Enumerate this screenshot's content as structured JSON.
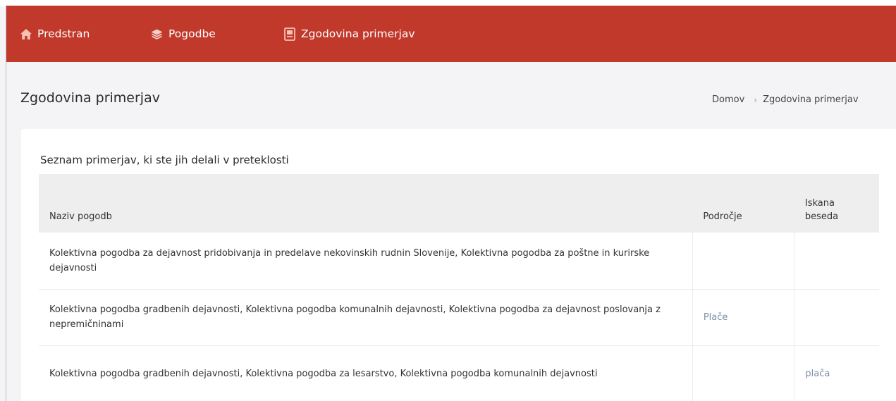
{
  "nav": {
    "home": "Predstran",
    "contracts": "Pogodbe",
    "history": "Zgodovina primerjav"
  },
  "icons": {
    "home": "home-icon",
    "contracts": "layers-icon",
    "history": "document-icon"
  },
  "colors": {
    "navbar": "#c0392b",
    "link": "#7d8da8"
  },
  "page": {
    "title": "Zgodovina primerjav"
  },
  "breadcrumb": {
    "home": "Domov",
    "current": "Zgodovina primerjav"
  },
  "card": {
    "title": "Seznam primerjav, ki ste jih delali v preteklosti"
  },
  "table": {
    "headers": {
      "name": "Naziv pogodb",
      "area": "Področje",
      "word_line1": "Iskana",
      "word_line2": "beseda"
    },
    "rows": [
      {
        "name": "Kolektivna pogodba za dejavnost pridobivanja in predelave nekovinskih rudnin Slovenije, Kolektivna pogodba za poštne in kurirske dejavnosti",
        "area": "",
        "word": ""
      },
      {
        "name": "Kolektivna pogodba gradbenih dejavnosti, Kolektivna pogodba komunalnih dejavnosti, Kolektivna pogodba za dejavnost poslovanja z nepremičninami",
        "area": "Plače",
        "word": ""
      },
      {
        "name": "Kolektivna pogodba gradbenih dejavnosti, Kolektivna pogodba za lesarstvo, Kolektivna pogodba komunalnih dejavnosti",
        "area": "",
        "word": "plača"
      }
    ]
  }
}
